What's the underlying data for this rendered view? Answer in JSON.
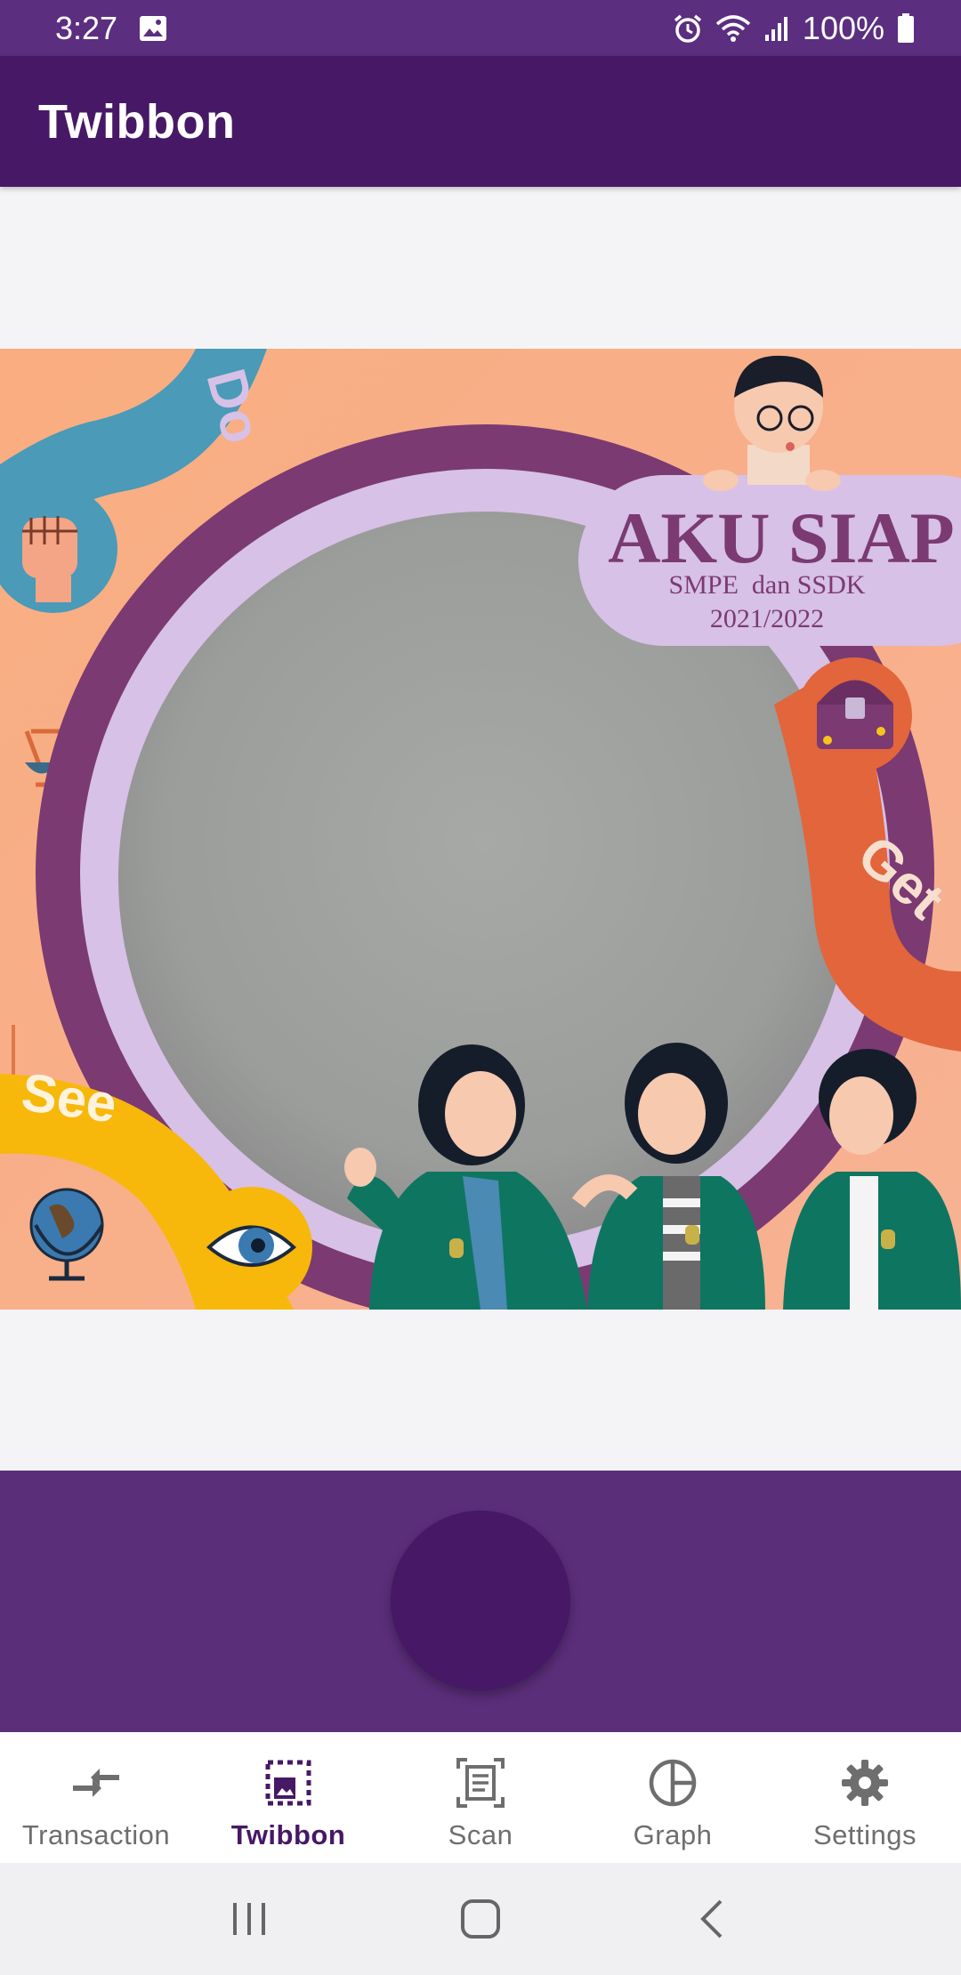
{
  "status_bar": {
    "time": "3:27",
    "battery": "100%",
    "icons": [
      "image-icon",
      "alarm-icon",
      "wifi-icon",
      "signal-icon",
      "battery-icon"
    ]
  },
  "app_bar": {
    "title": "Twibbon"
  },
  "twibbon": {
    "headline": "AKU SIAP",
    "subtitle": "SMPE  dan SSDK",
    "year": "2021/2022",
    "ribbon_top": "Do",
    "ribbon_right": "Get",
    "ribbon_left": "See"
  },
  "capture": {
    "button": "capture-shutter"
  },
  "bottom_nav": {
    "items": [
      {
        "label": "Transaction",
        "icon": "transfer-arrows-icon",
        "active": false
      },
      {
        "label": "Twibbon",
        "icon": "frame-image-icon",
        "active": true
      },
      {
        "label": "Scan",
        "icon": "document-scan-icon",
        "active": false
      },
      {
        "label": "Graph",
        "icon": "pie-chart-icon",
        "active": false
      },
      {
        "label": "Settings",
        "icon": "gear-icon",
        "active": false
      }
    ]
  },
  "colors": {
    "status_bar": "#5b2e7f",
    "app_bar": "#461866",
    "accent": "#461866",
    "frame_background": "#f9ad80"
  }
}
